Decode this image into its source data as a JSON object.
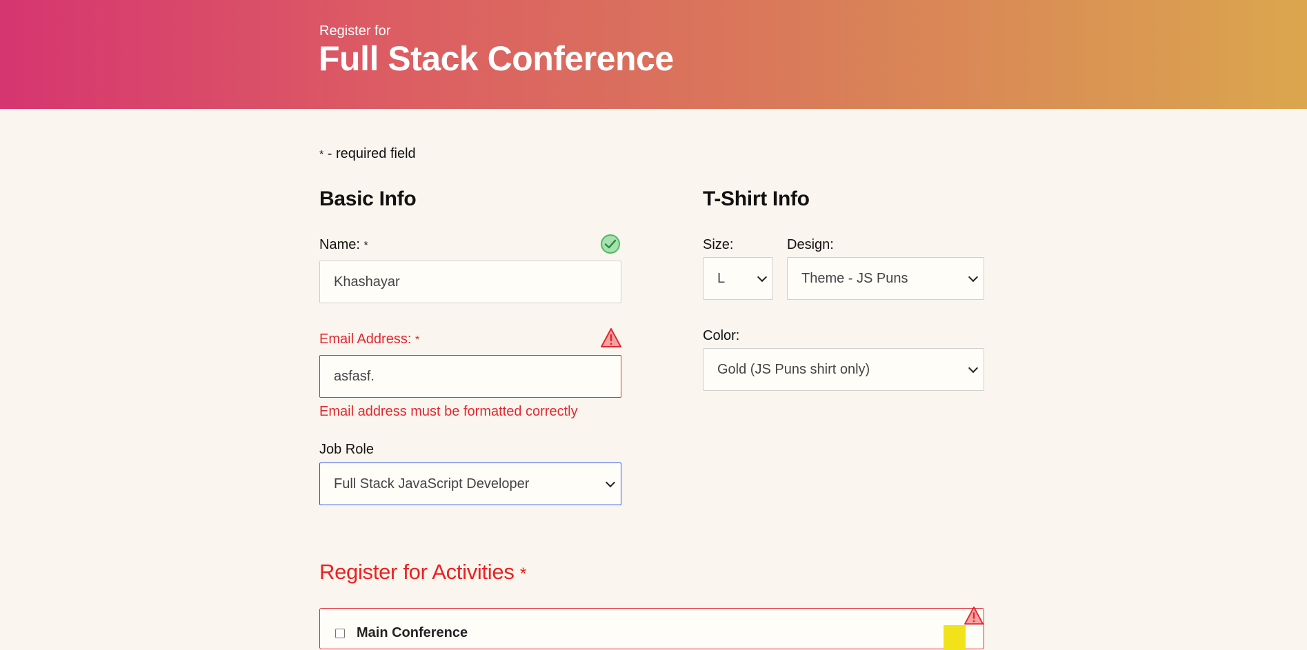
{
  "header": {
    "subtitle": "Register for",
    "title": "Full Stack Conference"
  },
  "required_note": {
    "star": "*",
    "text": " - required field"
  },
  "basic_info": {
    "heading": "Basic Info",
    "name": {
      "label": "Name:",
      "star": "*",
      "value": "Khashayar",
      "status": "valid"
    },
    "email": {
      "label": "Email Address:",
      "star": "*",
      "value": "asfasf.",
      "status": "error",
      "error_message": "Email address must be formatted correctly"
    },
    "job_role": {
      "label": "Job Role",
      "value": "Full Stack JavaScript Developer"
    }
  },
  "tshirt_info": {
    "heading": "T-Shirt Info",
    "size": {
      "label": "Size:",
      "value": "L"
    },
    "design": {
      "label": "Design:",
      "value": "Theme - JS Puns"
    },
    "color": {
      "label": "Color:",
      "value": "Gold (JS Puns shirt only)"
    }
  },
  "activities": {
    "heading": "Register for Activities",
    "star": "*",
    "first_item": "Main Conference"
  },
  "colors": {
    "error": "#e3262f",
    "valid": "#4cbb5e",
    "focus": "#2a56e6",
    "background": "#faf5ee"
  }
}
